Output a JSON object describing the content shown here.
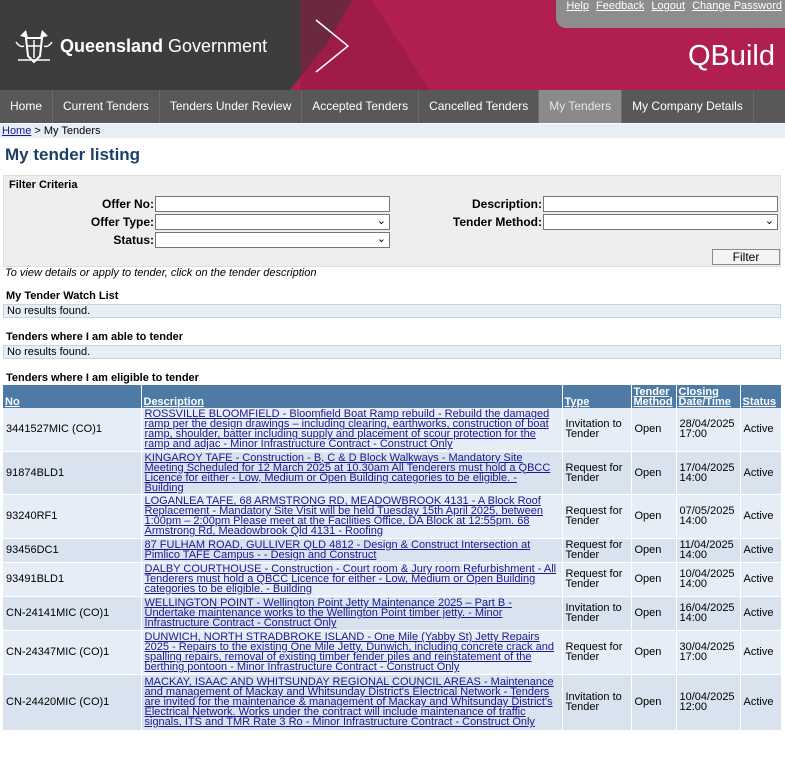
{
  "top_links": [
    "Help",
    "Feedback",
    "Logout",
    "Change Password"
  ],
  "header": {
    "gov_bold": "Queensland",
    "gov_rest": " Government",
    "app_name": "QBuild"
  },
  "nav": [
    {
      "label": "Home",
      "active": false
    },
    {
      "label": "Current Tenders",
      "active": false
    },
    {
      "label": "Tenders Under Review",
      "active": false
    },
    {
      "label": "Accepted Tenders",
      "active": false
    },
    {
      "label": "Cancelled Tenders",
      "active": false
    },
    {
      "label": "My Tenders",
      "active": true
    },
    {
      "label": "My Company Details",
      "active": false
    }
  ],
  "breadcrumb": {
    "home": "Home",
    "sep": " > ",
    "current": "My Tenders"
  },
  "page_title": "My tender listing",
  "filter": {
    "title": "Filter Criteria",
    "offer_no_label": "Offer No:",
    "offer_no_value": "",
    "offer_type_label": "Offer Type:",
    "offer_type_value": "",
    "status_label": "Status:",
    "status_value": "",
    "description_label": "Description:",
    "description_value": "",
    "tender_method_label": "Tender Method:",
    "tender_method_value": "",
    "button": "Filter"
  },
  "hint": "To view details or apply to tender, click on the tender description",
  "watch_list": {
    "title": "My Tender Watch List",
    "empty": "No results found."
  },
  "able": {
    "title": "Tenders where I am able to tender",
    "empty": "No results found."
  },
  "eligible": {
    "title": "Tenders where I am eligible to tender",
    "columns": [
      "No",
      "Description",
      "Type",
      "Tender Method",
      "Closing Date/Time",
      "Status"
    ],
    "rows": [
      {
        "no": "3441527MIC (CO)1",
        "description": "ROSSVILLE BLOOMFIELD - Bloomfield Boat Ramp rebuild - Rebuild the damaged ramp per the design drawings – including clearing, earthworks, construction of boat ramp, shoulder, batter including supply and placement of scour protection for the ramp and adjac - Minor Infrastructure Contract - Construct Only",
        "type": "Invitation to Tender",
        "method": "Open",
        "closing": "28/04/2025 17:00",
        "status": "Active"
      },
      {
        "no": "91874BLD1",
        "description": "KINGAROY TAFE - Construction - B, C & D Block Walkways - Mandatory Site Meeting Scheduled for 12 March 2025 at 10.30am All Tenderers must hold a QBCC Licence for either - Low, Medium or Open Building categories to be eligible. - Building",
        "type": "Request for Tender",
        "method": "Open",
        "closing": "17/04/2025 14:00",
        "status": "Active"
      },
      {
        "no": "93240RF1",
        "description": "LOGANLEA TAFE, 68 ARMSTRONG RD, MEADOWBROOK 4131 - A Block Roof Replacement - Mandatory Site Visit will be held Tuesday 15th April 2025, between 1:00pm – 2:00pm Please meet at the Facilities Office, DA Block at 12:55pm. 68 Armstrong Rd, Meadowbrook Qld 4131 - Roofing",
        "type": "Request for Tender",
        "method": "Open",
        "closing": "07/05/2025 14:00",
        "status": "Active"
      },
      {
        "no": "93456DC1",
        "description": "87 FULHAM ROAD, GULLIVER QLD 4812 - Design & Construct Intersection at Pimlico TAFE Campus - - Design and Construct",
        "type": "Request for Tender",
        "method": "Open",
        "closing": "11/04/2025 14:00",
        "status": "Active"
      },
      {
        "no": "93491BLD1",
        "description": "DALBY COURTHOUSE - Construction - Court room & Jury room Refurbishment - All Tenderers must hold a QBCC Licence for either - Low, Medium or Open Building categories to be eligible. - Building",
        "type": "Request for Tender",
        "method": "Open",
        "closing": "10/04/2025 14:00",
        "status": "Active"
      },
      {
        "no": "CN-24141MIC (CO)1",
        "description": "WELLINGTON POINT - Wellington Point Jetty Maintenance 2025 – Part B - Undertake maintenance works to the Wellington Point timber jetty. - Minor Infrastructure Contract - Construct Only",
        "type": "Invitation to Tender",
        "method": "Open",
        "closing": "16/04/2025 14:00",
        "status": "Active"
      },
      {
        "no": "CN-24347MIC (CO)1",
        "description": "DUNWICH, NORTH STRADBROKE ISLAND - One Mile (Yabby St) Jetty Repairs 2025 - Repairs to the existing One Mile Jetty, Dunwich, including concrete crack and spalling repairs, removal of existing timber fender piles and reinstatement of the berthing pontoon - Minor Infrastructure Contract - Construct Only",
        "type": "Request for Tender",
        "method": "Open",
        "closing": "30/04/2025 17:00",
        "status": "Active"
      },
      {
        "no": "CN-24420MIC (CO)1",
        "description": "MACKAY, ISAAC AND WHITSUNDAY REGIONAL COUNCIL AREAS - Maintenance and management of Mackay and Whitsunday District's Electrical Network - Tenders are invited for the maintenance & management of Mackay and Whitsunday District's Electrical Network. Works under the contract will include maintenance of traffic signals, ITS and TMR Rate 3 Ro - Minor Infrastructure Contract - Construct Only",
        "type": "Invitation to Tender",
        "method": "Open",
        "closing": "10/04/2025 12:00",
        "status": "Active"
      }
    ]
  }
}
